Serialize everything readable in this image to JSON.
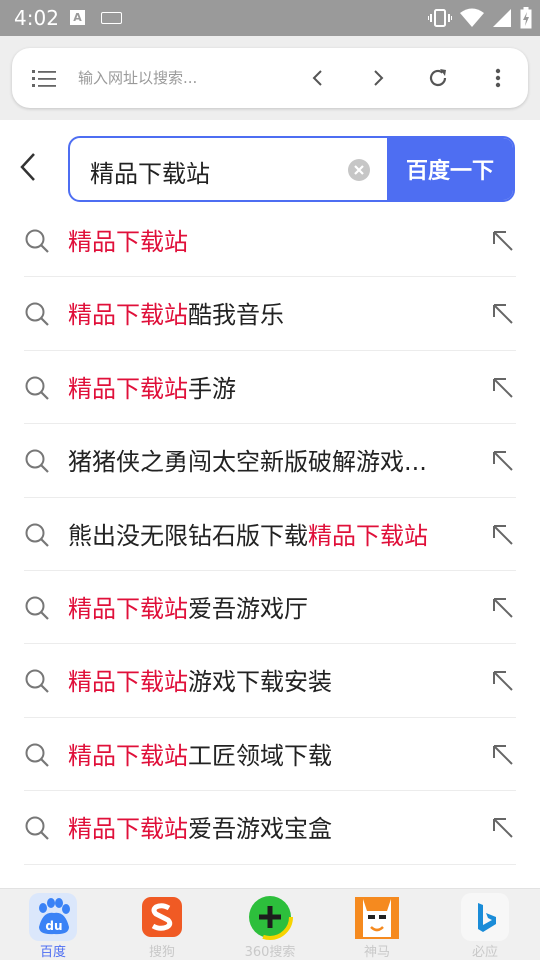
{
  "status_bar": {
    "time": "4:02",
    "a_icon_letter": "A"
  },
  "browser": {
    "url_placeholder": "输入网址以搜索..."
  },
  "search": {
    "query": "精品下载站",
    "submit_label": "百度一下"
  },
  "suggestions": [
    {
      "highlight": "精品下载站",
      "suffix": "",
      "prefix": ""
    },
    {
      "highlight": "精品下载站",
      "suffix": "酷我音乐",
      "prefix": ""
    },
    {
      "highlight": "精品下载站",
      "suffix": "手游",
      "prefix": ""
    },
    {
      "highlight": "",
      "suffix": "",
      "prefix": "猪猪侠之勇闯太空新版破解游戏..."
    },
    {
      "highlight": "精品下载站",
      "suffix": "",
      "prefix": "熊出没无限钻石版下载"
    },
    {
      "highlight": "精品下载站",
      "suffix": "爱吾游戏厅",
      "prefix": ""
    },
    {
      "highlight": "精品下载站",
      "suffix": "游戏下载安装",
      "prefix": ""
    },
    {
      "highlight": "精品下载站",
      "suffix": "工匠领域下载",
      "prefix": ""
    },
    {
      "highlight": "精品下载站",
      "suffix": "爱吾游戏宝盒",
      "prefix": ""
    }
  ],
  "engines": [
    {
      "label": "百度",
      "icon": "baidu-icon",
      "active": true
    },
    {
      "label": "搜狗",
      "icon": "sogou-icon",
      "active": false
    },
    {
      "label": "360搜索",
      "icon": "360-search-icon",
      "active": false
    },
    {
      "label": "神马",
      "icon": "shenma-icon",
      "active": false
    },
    {
      "label": "必应",
      "icon": "bing-icon",
      "active": false
    }
  ],
  "colors": {
    "accent": "#4e6ef2",
    "highlight": "#e0103a",
    "status_bar": "#9a9a9a"
  }
}
